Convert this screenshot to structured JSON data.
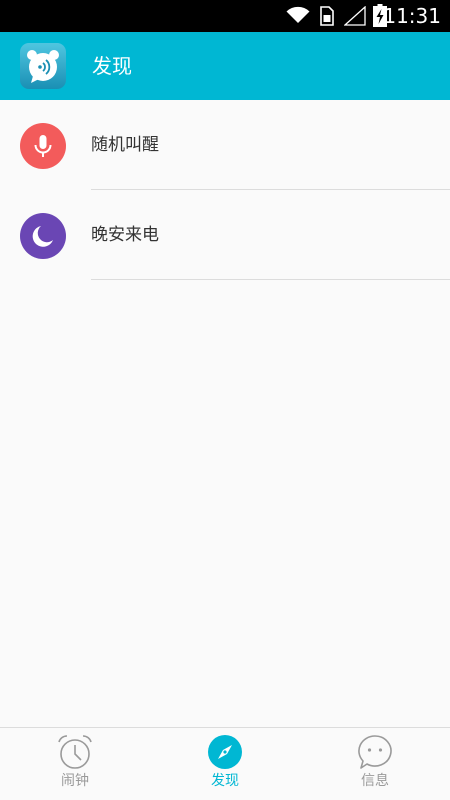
{
  "status_bar": {
    "time": "11:31",
    "icons": [
      "wifi-icon",
      "sim-card-icon",
      "signal-icon",
      "battery-charging-icon"
    ]
  },
  "app_bar": {
    "title": "发现",
    "logo_icon": "alarm-chat-logo-icon",
    "background": "#00b7d3"
  },
  "list": {
    "items": [
      {
        "label": "随机叫醒",
        "icon": "microphone-icon",
        "color": "#f35b5b"
      },
      {
        "label": "晚安来电",
        "icon": "moon-icon",
        "color": "#6a46b4"
      }
    ]
  },
  "bottom_nav": {
    "items": [
      {
        "label": "闹钟",
        "icon": "alarm-clock-icon",
        "active": false
      },
      {
        "label": "发现",
        "icon": "compass-icon",
        "active": true
      },
      {
        "label": "信息",
        "icon": "chat-bubble-icon",
        "active": false
      }
    ],
    "active_color": "#00b7d3",
    "inactive_color": "#9a9a9a"
  }
}
